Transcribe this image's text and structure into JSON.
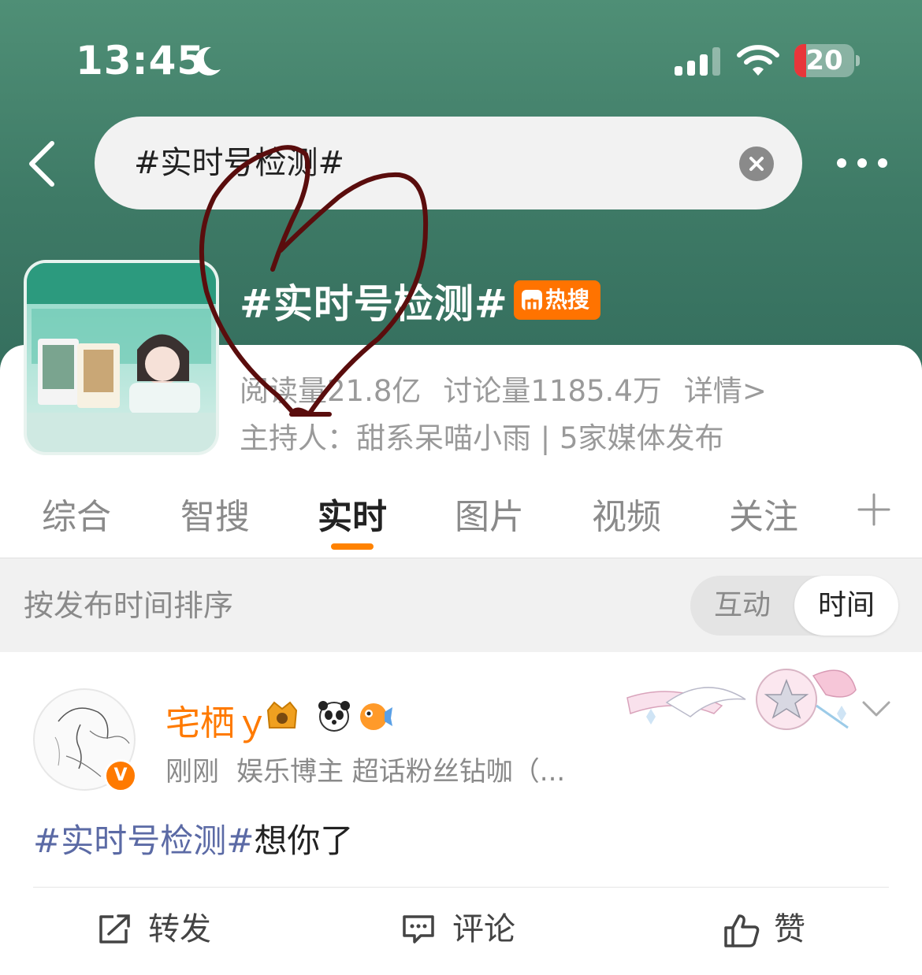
{
  "status_bar": {
    "time": "13:45",
    "battery": "20",
    "battery_level": 0.2
  },
  "search": {
    "query": "#实时号检测#"
  },
  "topic": {
    "title": "#实时号检测#",
    "hot_badge": "热搜",
    "reads": "阅读量21.8亿",
    "discussions": "讨论量1185.4万",
    "details_link": "详情>",
    "host_line": "主持人：甜系呆喵小雨 | 5家媒体发布"
  },
  "tabs": [
    {
      "label": "综合"
    },
    {
      "label": "智搜"
    },
    {
      "label": "实时",
      "active": true
    },
    {
      "label": "图片"
    },
    {
      "label": "视频"
    },
    {
      "label": "关注"
    }
  ],
  "sort": {
    "label": "按发布时间排序",
    "options": [
      "互动",
      "时间"
    ],
    "selected": "时间"
  },
  "post": {
    "author": "宅栖ｙ",
    "verified_badge": "V",
    "time": "刚刚",
    "description": "娱乐博主 超话粉丝钻咖（...",
    "hashtag": "#实时号检测#",
    "text": "想你了"
  },
  "actions": {
    "repost": "转发",
    "comment": "评论",
    "like": "赞"
  },
  "colors": {
    "accent": "#ff8200",
    "header_green": "#3e7a66",
    "hashtag": "#5b6aa5",
    "hot": "#ff7300"
  }
}
